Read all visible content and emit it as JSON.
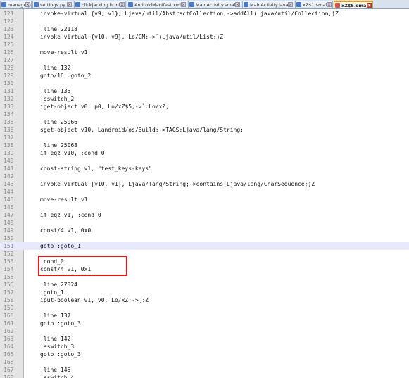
{
  "tabs": [
    {
      "label": "manage.py",
      "active": false
    },
    {
      "label": "settings.py",
      "active": false
    },
    {
      "label": "clickjacking.html",
      "active": false
    },
    {
      "label": "AndroidManifest.xml",
      "active": false
    },
    {
      "label": "MainActivity.smali",
      "active": false
    },
    {
      "label": "MainActivity.java",
      "active": false
    },
    {
      "label": "xZ$1.smali",
      "active": false
    },
    {
      "label": "xZ$5.smali",
      "active": true
    }
  ],
  "tab_close_glyph": "x",
  "editor": {
    "current_line": 151,
    "highlighted_lines": [
      153,
      154
    ],
    "highlight_color": "#e01818",
    "lines": [
      {
        "num": "121",
        "text": "    invoke-virtual {v9, v1}, Ljava/util/AbstractCollection;->addAll(Ljava/util/Collection;)Z"
      },
      {
        "num": "122",
        "text": ""
      },
      {
        "num": "123",
        "text": "    .line 22118"
      },
      {
        "num": "124",
        "text": "    invoke-virtual {v10, v9}, Lo/CM;->`(Ljava/util/List;)Z"
      },
      {
        "num": "125",
        "text": ""
      },
      {
        "num": "126",
        "text": "    move-result v1"
      },
      {
        "num": "127",
        "text": ""
      },
      {
        "num": "128",
        "text": "    .line 132"
      },
      {
        "num": "129",
        "text": "    goto/16 :goto_2"
      },
      {
        "num": "130",
        "text": ""
      },
      {
        "num": "131",
        "text": "    .line 135"
      },
      {
        "num": "132",
        "text": "    :sswitch_2"
      },
      {
        "num": "133",
        "text": "    iget-object v0, p0, Lo/xZ$5;->`:Lo/xZ;"
      },
      {
        "num": "134",
        "text": ""
      },
      {
        "num": "135",
        "text": "    .line 25066"
      },
      {
        "num": "136",
        "text": "    sget-object v10, Landroid/os/Build;->TAGS:Ljava/lang/String;"
      },
      {
        "num": "137",
        "text": ""
      },
      {
        "num": "138",
        "text": "    .line 25068"
      },
      {
        "num": "139",
        "text": "    if-eqz v10, :cond_0"
      },
      {
        "num": "140",
        "text": ""
      },
      {
        "num": "141",
        "text": "    const-string v1, \"test_keys-keys\""
      },
      {
        "num": "142",
        "text": ""
      },
      {
        "num": "143",
        "text": "    invoke-virtual {v10, v1}, Ljava/lang/String;->contains(Ljava/lang/CharSequence;)Z"
      },
      {
        "num": "144",
        "text": ""
      },
      {
        "num": "145",
        "text": "    move-result v1"
      },
      {
        "num": "146",
        "text": ""
      },
      {
        "num": "147",
        "text": "    if-eqz v1, :cond_0"
      },
      {
        "num": "148",
        "text": ""
      },
      {
        "num": "149",
        "text": "    const/4 v1, 0x0"
      },
      {
        "num": "150",
        "text": ""
      },
      {
        "num": "151",
        "text": "    goto :goto_1"
      },
      {
        "num": "152",
        "text": ""
      },
      {
        "num": "153",
        "text": "    :cond_0"
      },
      {
        "num": "154",
        "text": "    const/4 v1, 0x1"
      },
      {
        "num": "155",
        "text": ""
      },
      {
        "num": "156",
        "text": "    .line 27024"
      },
      {
        "num": "157",
        "text": "    :goto_1"
      },
      {
        "num": "158",
        "text": "    iput-boolean v1, v0, Lo/xZ;->¸:Z"
      },
      {
        "num": "159",
        "text": ""
      },
      {
        "num": "160",
        "text": "    .line 137"
      },
      {
        "num": "161",
        "text": "    goto :goto_3"
      },
      {
        "num": "162",
        "text": ""
      },
      {
        "num": "163",
        "text": "    .line 142"
      },
      {
        "num": "164",
        "text": "    :sswitch_3"
      },
      {
        "num": "165",
        "text": "    goto :goto_3"
      },
      {
        "num": "166",
        "text": ""
      },
      {
        "num": "167",
        "text": "    .line 145"
      },
      {
        "num": "168",
        "text": "    :sswitch_4"
      }
    ]
  }
}
